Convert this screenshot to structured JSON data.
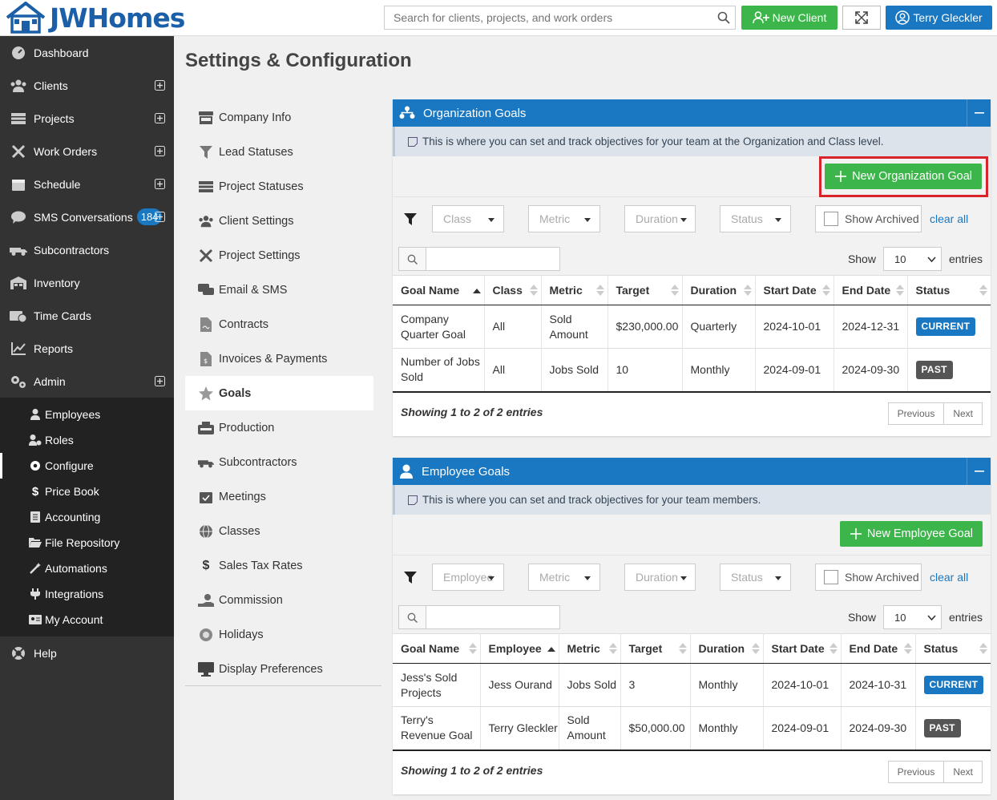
{
  "brand": {
    "name": "JWHomes"
  },
  "topbar": {
    "search_placeholder": "Search for clients, projects, and work orders",
    "new_client_label": "New Client",
    "user_name": "Terry Gleckler"
  },
  "sidebar": {
    "items": [
      {
        "label": "Dashboard",
        "icon": "dashboard-icon"
      },
      {
        "label": "Clients",
        "icon": "users-icon"
      },
      {
        "label": "Projects",
        "icon": "projects-icon"
      },
      {
        "label": "Work Orders",
        "icon": "tools-icon"
      },
      {
        "label": "Schedule",
        "icon": "calendar-icon"
      },
      {
        "label": "SMS Conversations",
        "icon": "sms-icon",
        "badge": "184"
      },
      {
        "label": "Subcontractors",
        "icon": "truck-icon"
      },
      {
        "label": "Inventory",
        "icon": "inventory-icon"
      },
      {
        "label": "Time Cards",
        "icon": "timecard-icon"
      },
      {
        "label": "Reports",
        "icon": "chart-icon"
      },
      {
        "label": "Admin",
        "icon": "cogs-icon"
      }
    ],
    "admin_sub": [
      {
        "label": "Employees"
      },
      {
        "label": "Roles"
      },
      {
        "label": "Configure"
      },
      {
        "label": "Price Book"
      },
      {
        "label": "Accounting"
      },
      {
        "label": "File Repository"
      },
      {
        "label": "Automations"
      },
      {
        "label": "Integrations"
      },
      {
        "label": "My Account"
      }
    ],
    "help_label": "Help"
  },
  "page": {
    "title": "Settings & Configuration"
  },
  "settings_menu": [
    {
      "label": "Company Info"
    },
    {
      "label": "Lead Statuses"
    },
    {
      "label": "Project Statuses"
    },
    {
      "label": "Client Settings"
    },
    {
      "label": "Project Settings"
    },
    {
      "label": "Email & SMS"
    },
    {
      "label": "Contracts"
    },
    {
      "label": "Invoices & Payments"
    },
    {
      "label": "Goals"
    },
    {
      "label": "Production"
    },
    {
      "label": "Subcontractors"
    },
    {
      "label": "Meetings"
    },
    {
      "label": "Classes"
    },
    {
      "label": "Sales Tax Rates"
    },
    {
      "label": "Commission"
    },
    {
      "label": "Holidays"
    },
    {
      "label": "Display Preferences"
    }
  ],
  "org_goals": {
    "title": "Organization Goals",
    "info": "This is where you can set and track objectives for your team at the Organization and Class level.",
    "new_button": "New Organization Goal",
    "filters": [
      "Class",
      "Metric",
      "Duration",
      "Status"
    ],
    "show_archived": "Show Archived",
    "clear_all": "clear all",
    "show_label": "Show",
    "entries_value": "10",
    "entries_label": "entries",
    "columns": [
      "Goal Name",
      "Class",
      "Metric",
      "Target",
      "Duration",
      "Start Date",
      "End Date",
      "Status"
    ],
    "rows": [
      {
        "goal": "Company Quarter Goal",
        "class": "All",
        "metric": "Sold Amount",
        "target": "$230,000.00",
        "duration": "Quarterly",
        "start": "2024-10-01",
        "end": "2024-12-31",
        "status": "CURRENT"
      },
      {
        "goal": "Number of Jobs Sold",
        "class": "All",
        "metric": "Jobs Sold",
        "target": "10",
        "duration": "Monthly",
        "start": "2024-09-01",
        "end": "2024-09-30",
        "status": "PAST"
      }
    ],
    "footer": "Showing 1 to 2 of 2 entries",
    "prev": "Previous",
    "next": "Next"
  },
  "emp_goals": {
    "title": "Employee Goals",
    "info": "This is where you can set and track objectives for your team members.",
    "new_button": "New Employee Goal",
    "filters": [
      "Employee",
      "Metric",
      "Duration",
      "Status"
    ],
    "show_archived": "Show Archived",
    "clear_all": "clear all",
    "show_label": "Show",
    "entries_value": "10",
    "entries_label": "entries",
    "columns": [
      "Goal Name",
      "Employee",
      "Metric",
      "Target",
      "Duration",
      "Start Date",
      "End Date",
      "Status"
    ],
    "rows": [
      {
        "goal": "Jess's Sold Projects",
        "employee": "Jess Ourand",
        "metric": "Jobs Sold",
        "target": "3",
        "duration": "Monthly",
        "start": "2024-10-01",
        "end": "2024-10-31",
        "status": "CURRENT"
      },
      {
        "goal": "Terry's Revenue Goal",
        "employee": "Terry Gleckler",
        "metric": "Sold Amount",
        "target": "$50,000.00",
        "duration": "Monthly",
        "start": "2024-09-01",
        "end": "2024-09-30",
        "status": "PAST"
      }
    ],
    "footer": "Showing 1 to 2 of 2 entries",
    "prev": "Previous",
    "next": "Next"
  }
}
